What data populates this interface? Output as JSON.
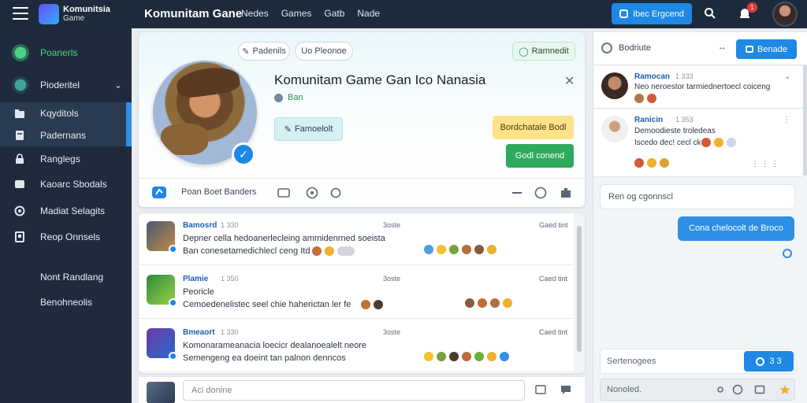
{
  "topbar": {
    "logo_line1": "Komunitsia",
    "logo_line2": "Game",
    "title": "Komunitam Gane",
    "nav": [
      "Nedes",
      "Games",
      "Gatb",
      "Nade"
    ],
    "cta_label": "Ibec Ergcend",
    "notif_count": "1"
  },
  "sidebar": {
    "items": [
      {
        "label": "Poanerls",
        "icon": "user-avatar-icon"
      },
      {
        "label": "Pioderitel",
        "icon": "user-avatar-icon"
      },
      {
        "label": "Kqyditols",
        "icon": "folder-icon"
      },
      {
        "label": "Padernans",
        "icon": "document-icon"
      },
      {
        "label": "Ranglegs",
        "icon": "lock-icon"
      },
      {
        "label": "Kaoarc Sbodals",
        "icon": "panel-icon"
      },
      {
        "label": "Madiat Selagits",
        "icon": "settings-icon"
      },
      {
        "label": "Reop Onnsels",
        "icon": "flag-icon"
      },
      {
        "label": "Nont Randlang",
        "icon": ""
      },
      {
        "label": "Benohneolis",
        "icon": ""
      }
    ]
  },
  "profile": {
    "chip1": "Padenils",
    "chip2": "Uo Pleonoe",
    "chip3": "Ramnedit",
    "name": "Komunitam Game Gan Ico Nanasia",
    "sub": "Ban",
    "btn_primary": "Famoelolt",
    "btn_yellow": "Bordchatale Bodl",
    "btn_green": "Godl conend",
    "footer_label": "Poan Boet Banders"
  },
  "feed": {
    "posts": [
      {
        "name": "Bamosrd",
        "meta": "1 330",
        "time": "3oste",
        "right": "Gaed tint",
        "line1": "Depner cella hedoanerlecleing ammidenrned soeista",
        "line2": "Ban conesetamedichlecl ceng Itd"
      },
      {
        "name": "Plamie",
        "meta": "1 350",
        "time": "3oste",
        "right": "Caed tint",
        "line1": "Peoricle",
        "line2": "Cemoedenelistec seel chie haherictan ler fe"
      },
      {
        "name": "Bmeaort",
        "meta": "1 330",
        "time": "3oste",
        "right": "Caed tint",
        "line1": "Komonarameanacia loecicr dealanoealelt neore",
        "line2": "Semengeng ea doeint tan palnon denncos"
      }
    ],
    "composer_placeholder": "Aci donine"
  },
  "rightpanel": {
    "title": "Bodriute",
    "button": "Benade",
    "messages": [
      {
        "name": "Ramocan",
        "meta": "1 333",
        "line1": "Neo neroestor tarmiednertoecl coiceng",
        "line2": ""
      },
      {
        "name": "Ranicin",
        "meta": "1 353",
        "line1": "Demoodieste troledeas",
        "line2": "Iscedo dec! cecl ck"
      }
    ],
    "bubble_left": "Ren og cgonnscl",
    "bubble_right": "Cona chelocolt de Broco",
    "field_placeholder": "Sertenogees",
    "send_label": "3 3",
    "compose_placeholder": "Nonoled."
  },
  "colors": {
    "accent": "#1e88e5",
    "sidebar_bg": "#1f2b3c",
    "green": "#2eaa5c",
    "yellow": "#ffe38a"
  }
}
